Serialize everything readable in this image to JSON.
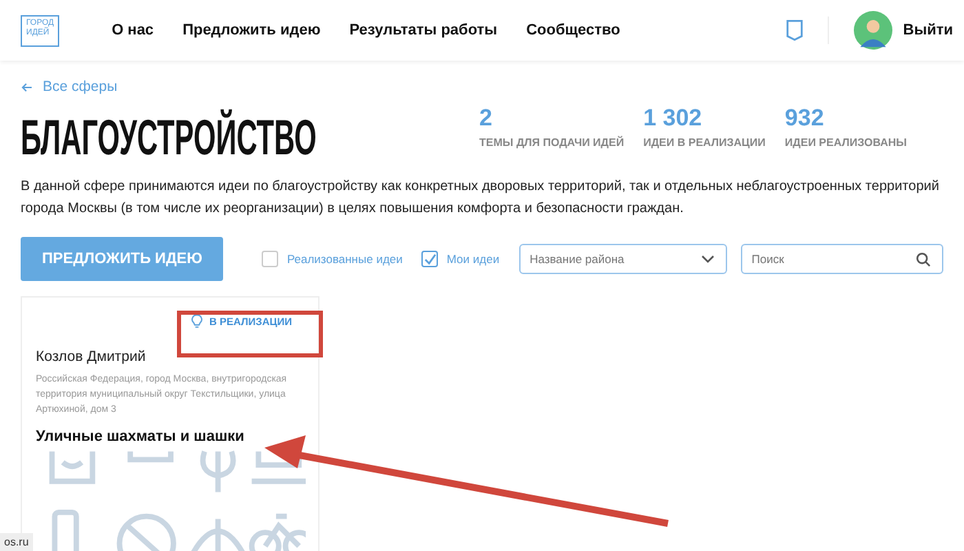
{
  "header": {
    "logo": [
      "ГОРОД",
      "ИДЕЙ"
    ],
    "nav": [
      "О нас",
      "Предложить идею",
      "Результаты работы",
      "Сообщество"
    ],
    "logout": "Выйти"
  },
  "back_link": "Все сферы",
  "title": "БЛАГОУСТРОЙСТВО",
  "stats": [
    {
      "value": "2",
      "label": "ТЕМЫ ДЛЯ ПОДАЧИ ИДЕЙ"
    },
    {
      "value": "1 302",
      "label": "ИДЕИ В РЕАЛИЗАЦИИ"
    },
    {
      "value": "932",
      "label": "ИДЕИ РЕАЛИЗОВАНЫ"
    }
  ],
  "description": "В данной сфере принимаются идеи по благоустройству как конкретных дворовых территорий, так и отдельных неблагоустроенных территорий города Москвы (в том числе их реорганизации) в целях повышения комфорта и безопасности граждан.",
  "filters": {
    "button": "ПРЕДЛОЖИТЬ ИДЕЮ",
    "checkboxes": [
      {
        "label": "Реализованные идеи",
        "checked": false
      },
      {
        "label": "Мои идеи",
        "checked": true
      }
    ],
    "district": {
      "placeholder": "Название района"
    },
    "search": {
      "placeholder": "Поиск"
    }
  },
  "card": {
    "status": "В РЕАЛИЗАЦИИ",
    "author": "Козлов Дмитрий",
    "address": "Российская Федерация, город Москва, внутригородская территория муниципальный округ Текстильщики, улица Артюхиной, дом 3",
    "title": "Уличные шахматы и шашки"
  },
  "status_bar": "os.ru"
}
